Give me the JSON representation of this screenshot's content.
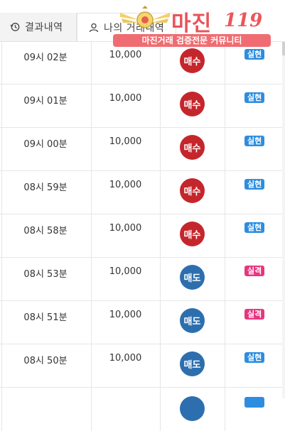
{
  "tabs": [
    {
      "label": "결과내역",
      "icon": "history-icon"
    },
    {
      "label": "나의 거래내역",
      "icon": "user-icon"
    }
  ],
  "logo": {
    "title": "마진",
    "number": "119",
    "banner": "마진거래 검증전문 커뮤니티"
  },
  "colors": {
    "buy": "#c5262c",
    "sell": "#2d6fae",
    "win": "#2d8de0",
    "lose": "#e8357f",
    "logo": "#e8454b"
  },
  "rows": [
    {
      "time": "09시 02분",
      "amount": "10,000",
      "action": "매수",
      "result": "실현"
    },
    {
      "time": "09시 01분",
      "amount": "10,000",
      "action": "매수",
      "result": "실현"
    },
    {
      "time": "09시 00분",
      "amount": "10,000",
      "action": "매수",
      "result": "실현"
    },
    {
      "time": "08시 59분",
      "amount": "10,000",
      "action": "매수",
      "result": "실현"
    },
    {
      "time": "08시 58분",
      "amount": "10,000",
      "action": "매수",
      "result": "실현"
    },
    {
      "time": "08시 53분",
      "amount": "10,000",
      "action": "매도",
      "result": "실격"
    },
    {
      "time": "08시 51분",
      "amount": "10,000",
      "action": "매도",
      "result": "실격"
    },
    {
      "time": "08시 50분",
      "amount": "10,000",
      "action": "매도",
      "result": "실현"
    },
    {
      "time": "",
      "amount": "",
      "action": "",
      "result": ""
    }
  ]
}
